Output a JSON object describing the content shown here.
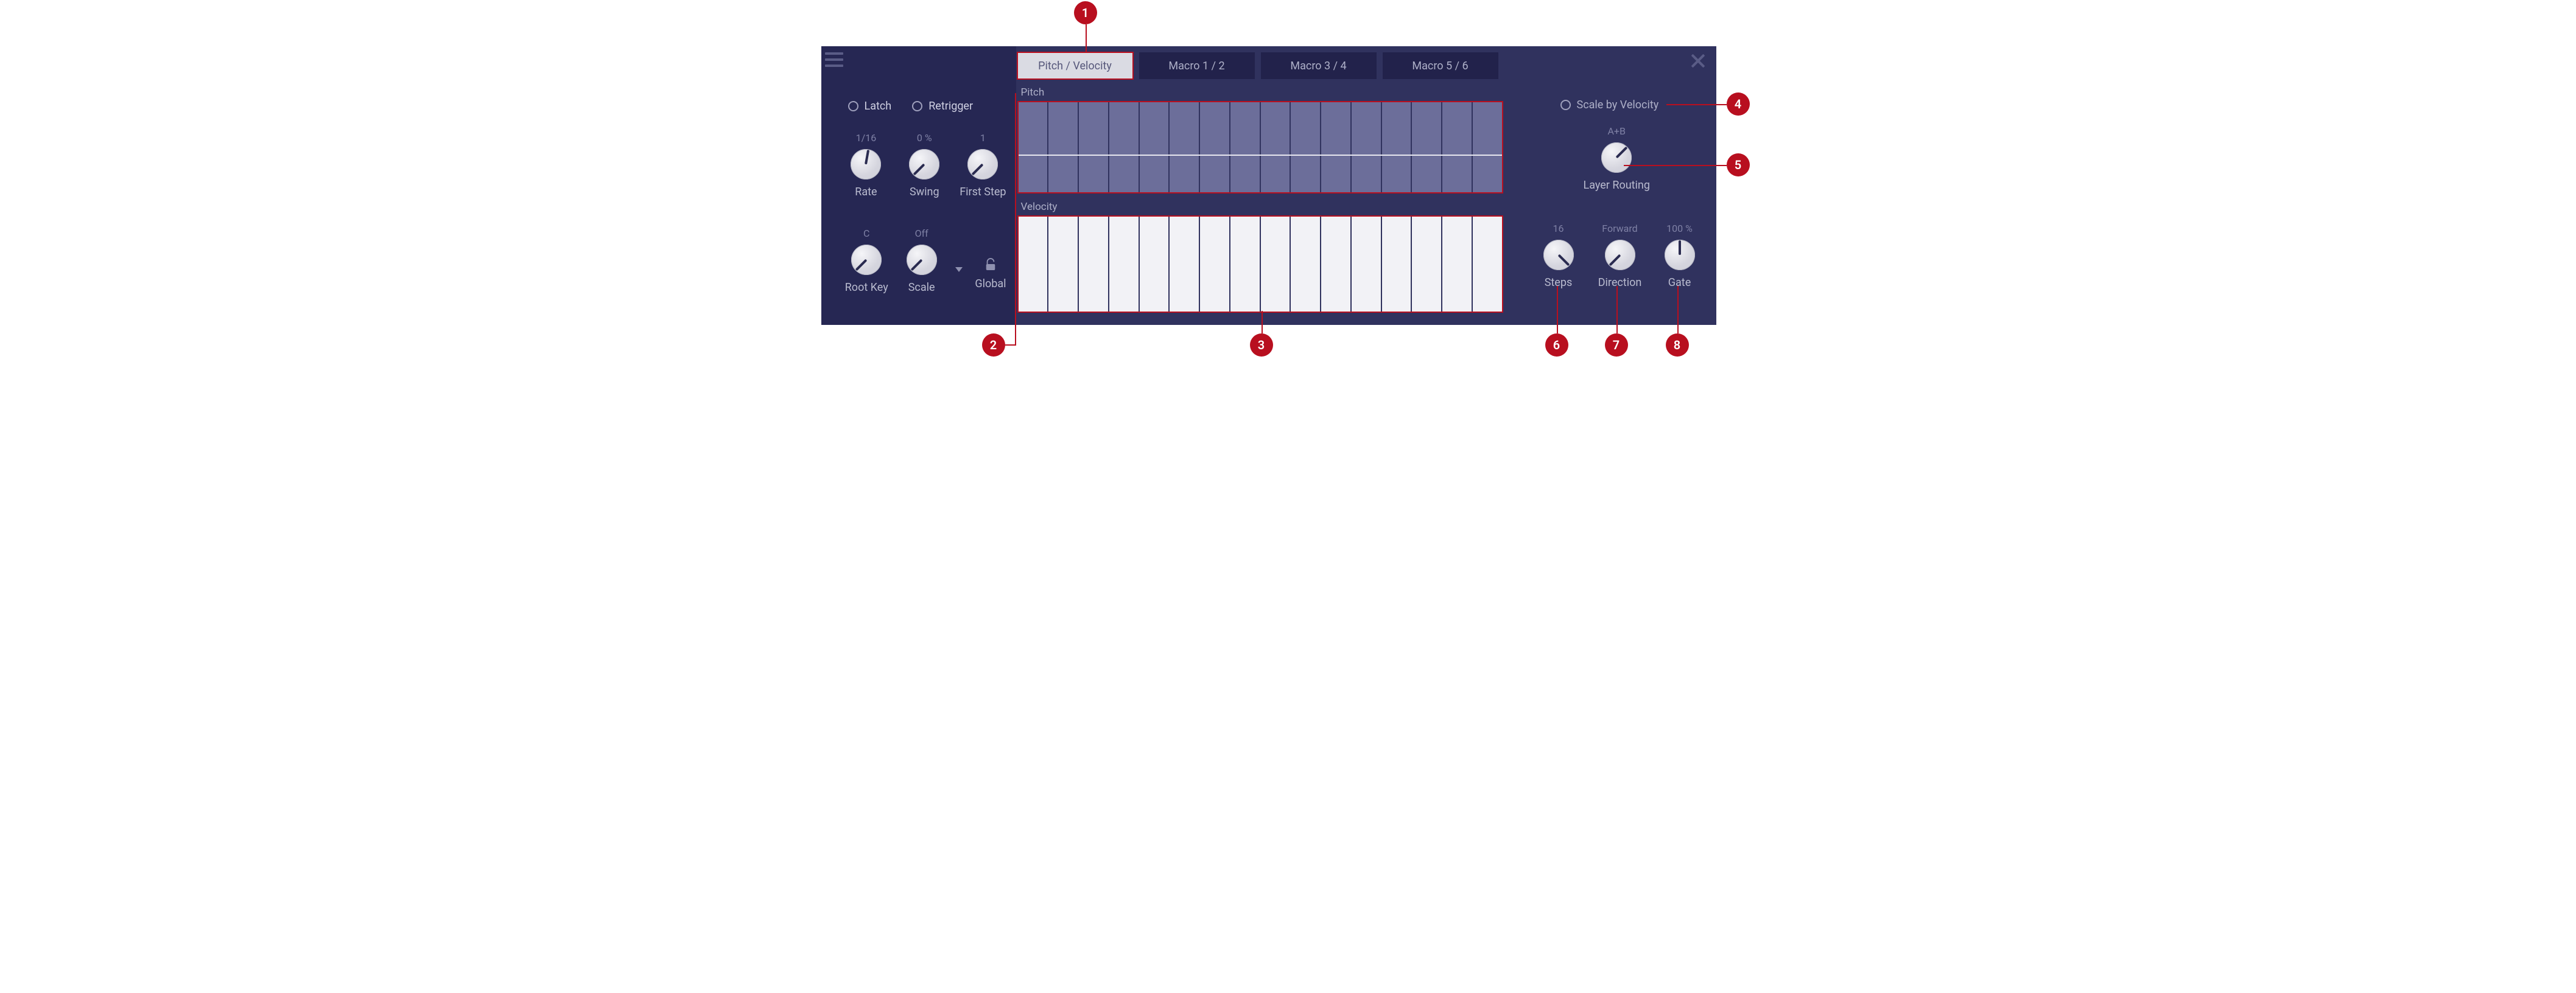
{
  "callouts": {
    "c1": "1",
    "c2": "2",
    "c3": "3",
    "c4": "4",
    "c5": "5",
    "c6": "6",
    "c7": "7",
    "c8": "8"
  },
  "left": {
    "latch": "Latch",
    "retrigger": "Retrigger",
    "rate": {
      "value": "1/16",
      "label": "Rate"
    },
    "swing": {
      "value": "0 %",
      "label": "Swing"
    },
    "firstStep": {
      "value": "1",
      "label": "First Step"
    },
    "rootKey": {
      "value": "C",
      "label": "Root Key"
    },
    "scale": {
      "value": "Off",
      "label": "Scale"
    },
    "global": {
      "label": "Global"
    }
  },
  "tabs": {
    "t1": "Pitch / Velocity",
    "t2": "Macro 1 / 2",
    "t3": "Macro 3 / 4",
    "t4": "Macro 5 / 6"
  },
  "lanes": {
    "pitch": "Pitch",
    "velocity": "Velocity"
  },
  "right": {
    "scaleByVel": "Scale by Velocity",
    "layerRouting": {
      "value": "A+B",
      "label": "Layer Routing"
    },
    "steps": {
      "value": "16",
      "label": "Steps"
    },
    "direction": {
      "value": "Forward",
      "label": "Direction"
    },
    "gate": {
      "value": "100 %",
      "label": "Gate"
    }
  }
}
